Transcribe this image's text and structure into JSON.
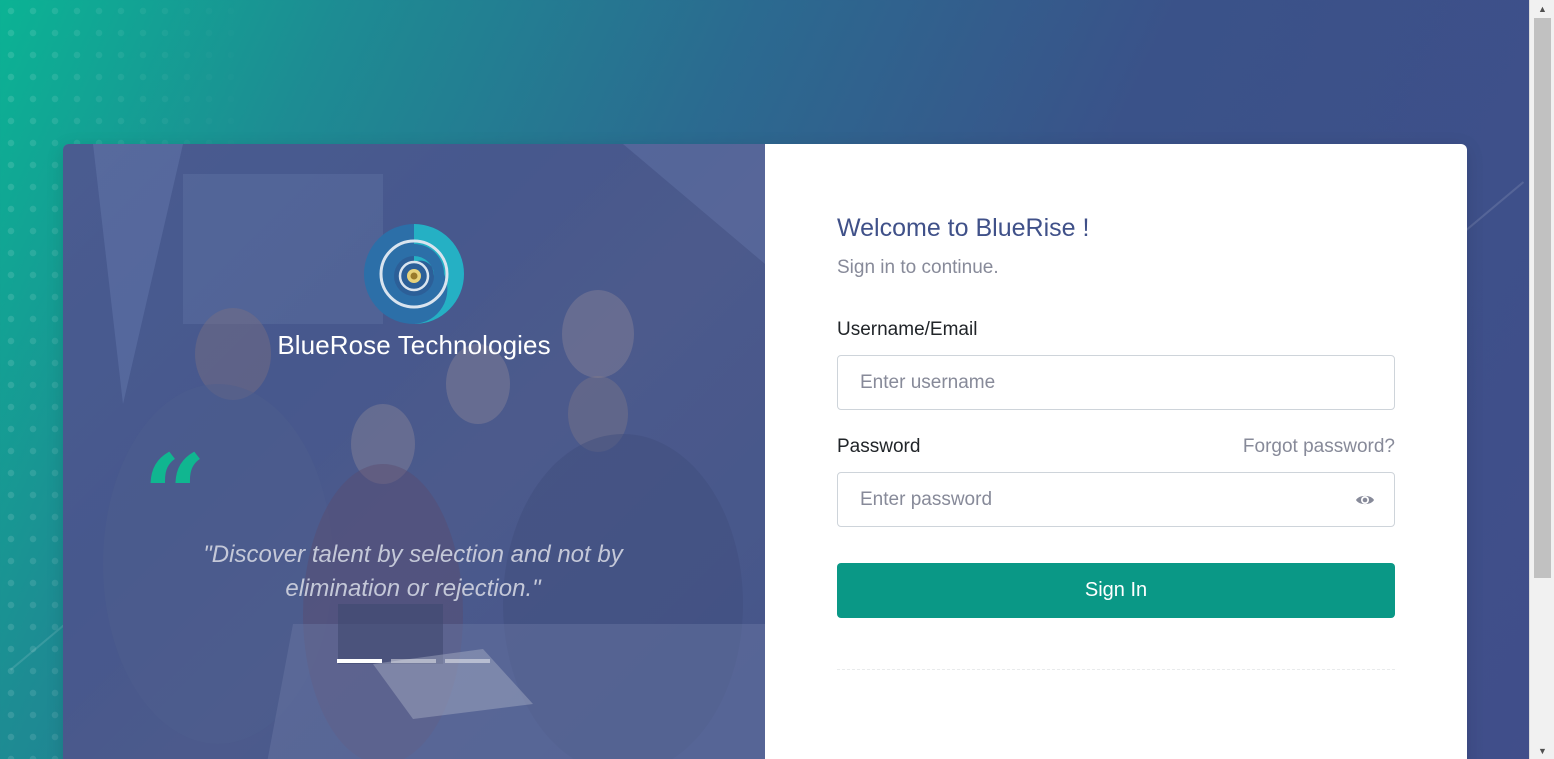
{
  "colors": {
    "primary": "#405189",
    "accent": "#0a9886",
    "quote_accent": "#10b690",
    "muted": "#878a99"
  },
  "left_panel": {
    "brand_name": "BlueRose Technologies",
    "logo_icon": "bluerose-swirl-logo",
    "quote_icon": "quote-open-icon",
    "quote": "\"Discover talent by selection and not by elimination or rejection.\"",
    "carousel": {
      "slide_count": 3,
      "active_index": 0
    }
  },
  "form": {
    "title": "Welcome to BlueRise !",
    "subtitle": "Sign in to continue.",
    "username_label": "Username/Email",
    "username_placeholder": "Enter username",
    "username_value": "",
    "password_label": "Password",
    "forgot_label": "Forgot password?",
    "password_placeholder": "Enter password",
    "password_value": "",
    "password_toggle_icon": "eye-icon",
    "signin_label": "Sign In"
  }
}
